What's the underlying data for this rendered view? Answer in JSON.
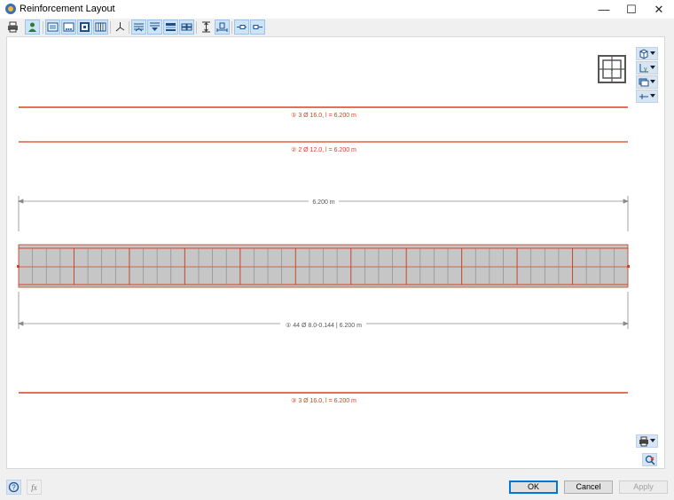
{
  "window": {
    "title": "Reinforcement Layout",
    "minimize_glyph": "—",
    "maximize_glyph": "☐",
    "close_glyph": "✕"
  },
  "toolbar": {
    "buttons": [
      "print-icon",
      "person-icon",
      "view-frame-icon",
      "view-dots-icon",
      "view-box-icon",
      "view-bars-icon",
      "axes-icon",
      "layers-top-icon",
      "layers-middle-icon",
      "layers-bottom-icon",
      "layers-grid-icon",
      "dimension-vertical-icon",
      "dimension-horizontal-icon",
      "bar-left-icon",
      "bar-right-icon"
    ]
  },
  "drawing": {
    "bar_top_1": "① 3 Ø 16.0, l = 6.200 m",
    "bar_top_2": "② 2 Ø 12.0, l = 6.200 m",
    "length_dim": "6.200 m",
    "stirrups": "① 44 Ø 8.0-0.144 | 6.200 m",
    "bar_bottom": "③ 3 Ø 16.0, l = 6.200 m",
    "stirrup_count": 44
  },
  "side_tools": [
    "cube-view-icon",
    "axis-y-icon",
    "render-icon",
    "section-icon"
  ],
  "footer": {
    "ok": "OK",
    "cancel": "Cancel",
    "apply": "Apply"
  },
  "colors": {
    "rebar": "#d9401f",
    "dim": "#8a8a8a",
    "concrete": "#c6c6c6",
    "accent": "#0078d7"
  }
}
